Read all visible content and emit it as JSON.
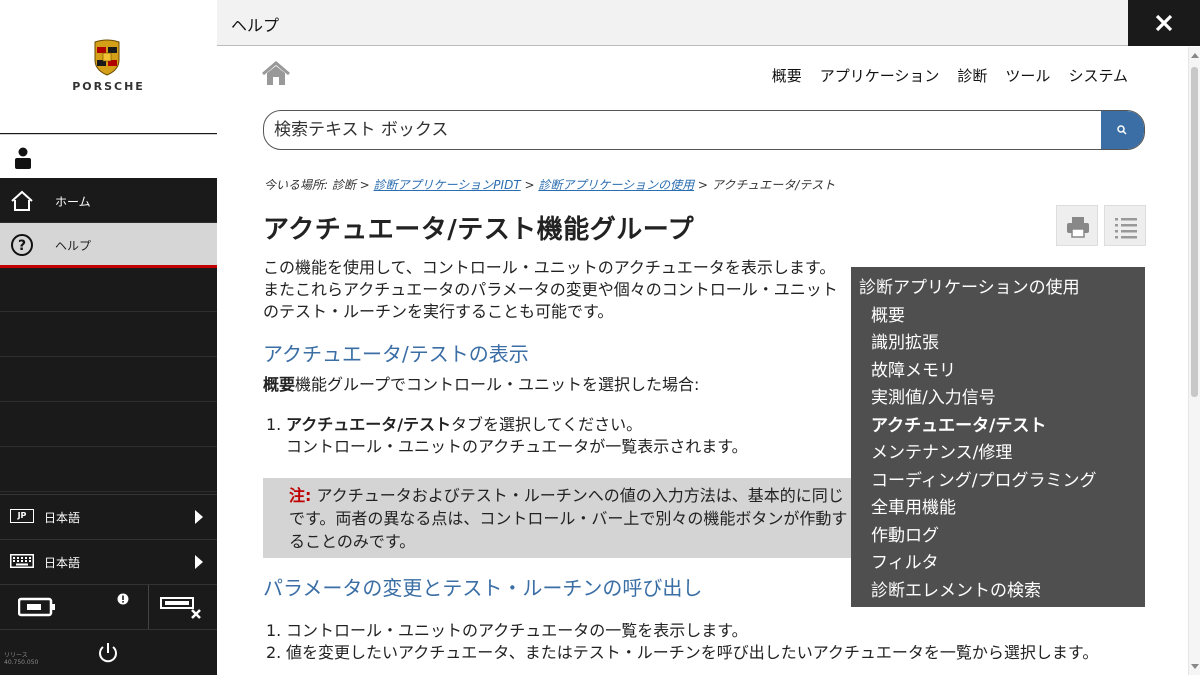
{
  "brand": "PORSCHE",
  "header": {
    "title": "ヘルプ"
  },
  "sidebar": {
    "nav": [
      {
        "label": "ホーム",
        "icon": "home-icon"
      },
      {
        "label": "ヘルプ",
        "icon": "help-icon",
        "active": true
      }
    ],
    "language_rows": [
      {
        "badge": "JP",
        "label": "日本語",
        "icon": "jp-flag-icon"
      },
      {
        "label": "日本語",
        "icon": "keyboard-icon"
      }
    ],
    "release_label": "リリース",
    "release_version": "40.750.050"
  },
  "topnav": [
    "概要",
    "アプリケーション",
    "診断",
    "ツール",
    "システム"
  ],
  "search": {
    "placeholder": "検索テキスト ボックス"
  },
  "breadcrumb": {
    "prefix": "今いる場所: 診断 > ",
    "link1": "診断アプリケーションPIDT",
    "sep1": " > ",
    "link2": "診断アプリケーションの使用",
    "tail": " > アクチュエータ/テスト"
  },
  "page": {
    "title": "アクチュエータ/テスト機能グループ",
    "intro": "この機能を使用して、コントロール・ユニットのアクチュエータを表示します。またこれらアクチュエータのパラメータの変更や個々のコントロール・ユニットのテスト・ルーチンを実行することも可能です。",
    "section1_title": "アクチュエータ/テストの表示",
    "section1_lead_bold": "概要",
    "section1_lead_rest": "機能グループでコントロール・ユニットを選択した場合:",
    "step1_num": "1.",
    "step1_bold": "アクチュエータ/テスト",
    "step1_rest": "タブを選択してください。",
    "step1_sub": "コントロール・ユニットのアクチュエータが一覧表示されます。",
    "note_label": "注:",
    "note_text": " アクチュータおよびテスト・ルーチンへの値の入力方法は、基本的に同じです。両者の異なる点は、コントロール・バー上で別々の機能ボタンが作動することのみです。",
    "section2_title": "パラメータの変更とテスト・ルーチンの呼び出し",
    "s2_step1_num": "1.",
    "s2_step1": "コントロール・ユニットのアクチュエータの一覧を表示します。",
    "s2_step2_num": "2.",
    "s2_step2": "値を変更したいアクチュエータ、またはテスト・ルーチンを呼び出したいアクチュエータを一覧から選択します。"
  },
  "toc": {
    "heading": "診断アプリケーションの使用",
    "items": [
      "概要",
      "識別拡張",
      "故障メモリ",
      "実測値/入力信号",
      "アクチュエータ/テスト",
      "メンテナンス/修理",
      "コーディング/プログラミング",
      "全車用機能",
      "作動ログ",
      "フィルタ",
      "診断エレメントの検索"
    ],
    "active_index": 4
  },
  "colors": {
    "sidebar_bg": "#1a1a1a",
    "accent_red": "#c00000",
    "link_blue": "#2a6db0",
    "heading_blue": "#3a6ea5",
    "toc_bg": "#4f4f4f"
  }
}
